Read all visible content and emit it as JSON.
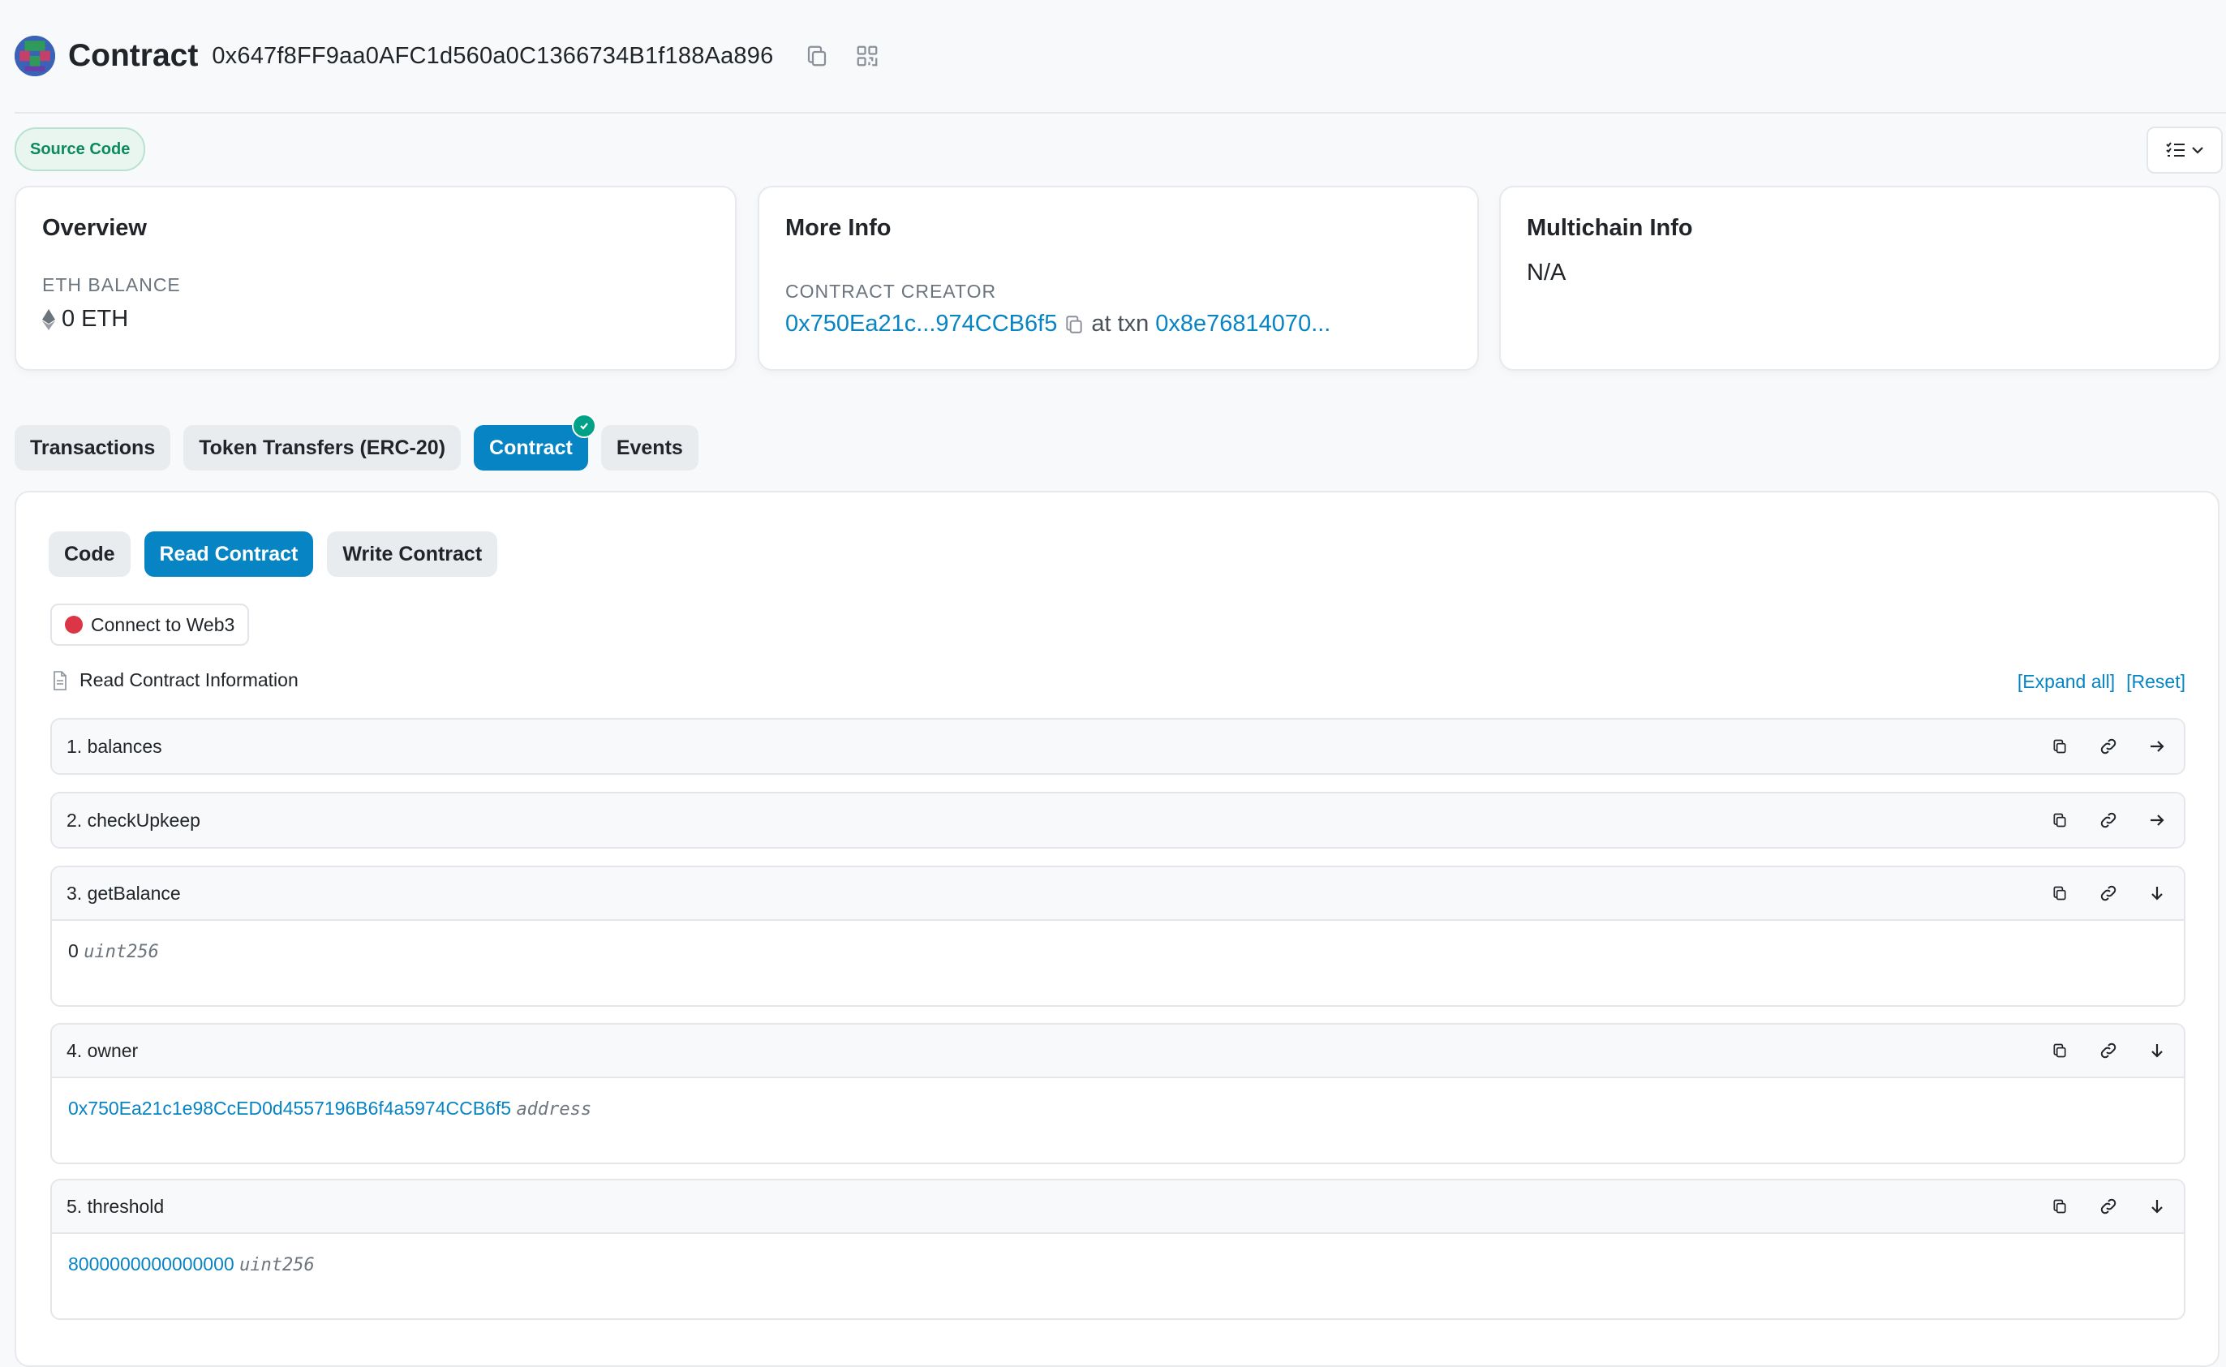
{
  "header": {
    "title": "Contract",
    "address": "0x647f8FF9aa0AFC1d560a0C1366734B1f188Aa896"
  },
  "source_code_badge": "Source Code",
  "cards": {
    "overview": {
      "title": "Overview",
      "balance_label": "ETH BALANCE",
      "balance_value": "0 ETH"
    },
    "more_info": {
      "title": "More Info",
      "creator_label": "CONTRACT CREATOR",
      "creator_address": "0x750Ea21c...974CCB6f5",
      "at_txn": "at txn",
      "txn_hash": "0x8e76814070..."
    },
    "multichain": {
      "title": "Multichain Info",
      "value": "N/A"
    }
  },
  "tabs": [
    "Transactions",
    "Token Transfers (ERC-20)",
    "Contract",
    "Events"
  ],
  "subtabs": [
    "Code",
    "Read Contract",
    "Write Contract"
  ],
  "connect_label": "Connect to Web3",
  "read_info_label": "Read Contract Information",
  "expand_all": "[Expand all]",
  "reset": "[Reset]",
  "functions": [
    {
      "name": "1. balances"
    },
    {
      "name": "2. checkUpkeep"
    },
    {
      "name": "3. getBalance",
      "value": "0",
      "type": "uint256"
    },
    {
      "name": "4. owner",
      "value": "0x750Ea21c1e98CcED0d4557196B6f4a5974CCB6f5",
      "type": "address"
    },
    {
      "name": "5. threshold",
      "value": "8000000000000000",
      "type": "uint256"
    }
  ],
  "colors": {
    "accent": "#0784c3",
    "success": "#00a186",
    "danger": "#dc3545"
  }
}
